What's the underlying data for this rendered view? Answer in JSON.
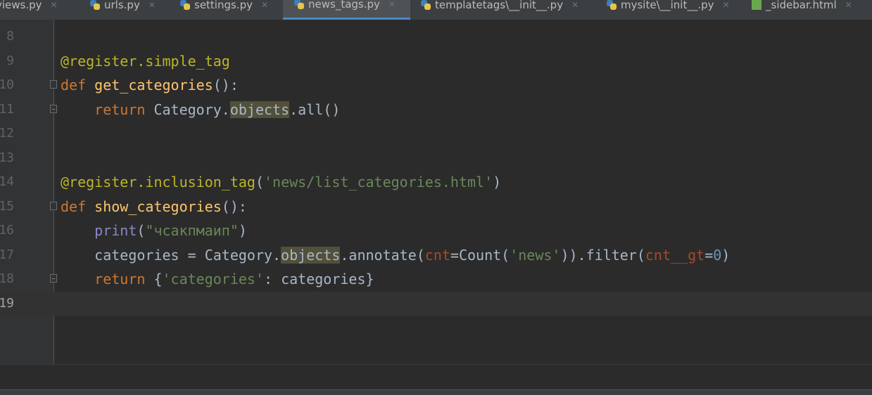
{
  "tabs": [
    {
      "label": "views.py",
      "icon": "python-file-icon"
    },
    {
      "label": "urls.py",
      "icon": "python-file-icon"
    },
    {
      "label": "settings.py",
      "icon": "python-file-icon"
    },
    {
      "label": "news_tags.py",
      "icon": "python-file-icon",
      "active": true
    },
    {
      "label": "templatetags\\__init__.py",
      "icon": "python-file-icon"
    },
    {
      "label": "mysite\\__init__.py",
      "icon": "python-file-icon"
    },
    {
      "label": "_sidebar.html",
      "icon": "html-file-icon"
    }
  ],
  "editor": {
    "current_line": 19,
    "lines": [
      {
        "n": "8"
      },
      {
        "n": "9",
        "parts": [
          "@register.simple_tag"
        ]
      },
      {
        "n": "10",
        "parts": [
          "def",
          " ",
          "get_categories",
          "():"
        ]
      },
      {
        "n": "11",
        "parts": [
          "    ",
          "return",
          " Category.",
          "objects",
          ".all()"
        ]
      },
      {
        "n": "12"
      },
      {
        "n": "13"
      },
      {
        "n": "14",
        "parts": [
          "@register.inclusion_tag",
          "(",
          "'news/list_categories.html'",
          ")"
        ]
      },
      {
        "n": "15",
        "parts": [
          "def",
          " ",
          "show_categories",
          "():"
        ]
      },
      {
        "n": "16",
        "parts": [
          "    ",
          "print",
          "(",
          "\"чсакпмаип\"",
          ")"
        ]
      },
      {
        "n": "17",
        "parts": [
          "    categories = Category.",
          "objects",
          ".annotate(",
          "cnt",
          "=Count(",
          "'news'",
          ")).filter(",
          "cnt__gt",
          "=",
          "0",
          ")"
        ]
      },
      {
        "n": "18",
        "parts": [
          "    ",
          "return",
          " {",
          "'categories'",
          ": categories}"
        ]
      },
      {
        "n": "19"
      }
    ]
  }
}
